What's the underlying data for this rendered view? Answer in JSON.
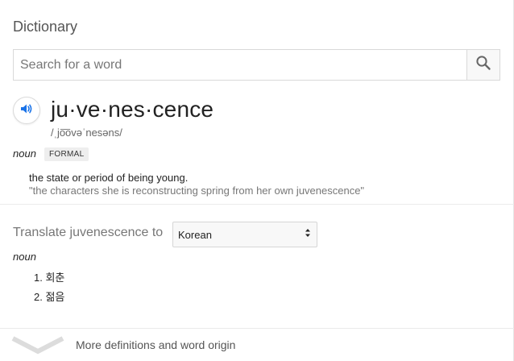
{
  "card": {
    "title": "Dictionary"
  },
  "search": {
    "placeholder": "Search for a word",
    "value": ""
  },
  "entry": {
    "headword": "ju·ve·nes·cence",
    "phonetic": "/ˌjo͞ovəˈnesəns/",
    "part_of_speech": "noun",
    "register_badge": "FORMAL",
    "definition": "the state or period of being young.",
    "example": "\"the characters she is reconstructing spring from her own juvenescence\""
  },
  "translate": {
    "label": "Translate juvenescence to",
    "selected_language": "Korean",
    "part_of_speech": "noun",
    "items": [
      {
        "num": "1.",
        "text": "회춘"
      },
      {
        "num": "2.",
        "text": "젊음"
      }
    ]
  },
  "footer": {
    "more_label": "More definitions and word origin"
  },
  "icons": {
    "search": "search-icon",
    "speaker": "speaker-icon",
    "select": "select-arrows-icon",
    "expand": "chevron-down-icon"
  },
  "colors": {
    "speaker_accent": "#1a73e8",
    "icon_gray": "#666666"
  }
}
